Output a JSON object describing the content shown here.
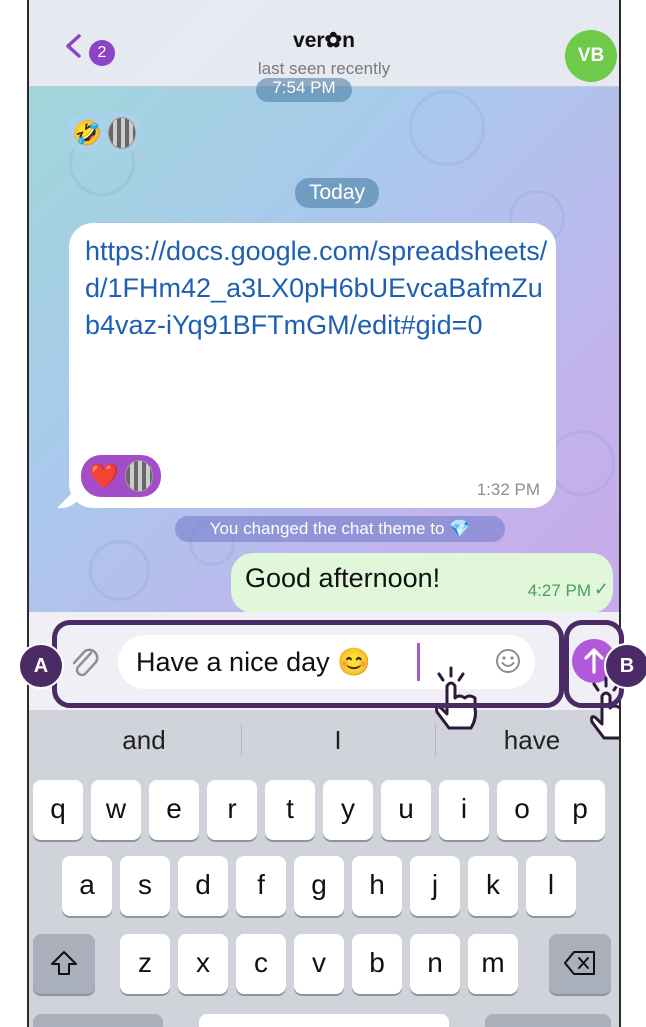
{
  "header": {
    "back_badge": "2",
    "contact_name": "ver✿n",
    "status": "last seen recently",
    "avatar_initials": "VB"
  },
  "messages": {
    "earlier_time": "7:54 PM",
    "earlier_reactions": [
      "🤣"
    ],
    "date_separator": "Today",
    "incoming": {
      "text": "https://docs.google.com/spreadsheets/d/1FHm42_a3LX0pH6bUEvcaBafmZub4vaz-iYq91BFTmGM/edit#gid=0",
      "reaction": "❤️",
      "time": "1:32 PM"
    },
    "service": "You changed the chat theme to 💎",
    "outgoing": {
      "text": "Good afternoon!",
      "time": "4:27 PM",
      "status": "✓"
    }
  },
  "composer": {
    "value": "Have a nice day 😊"
  },
  "markers": {
    "a": "A",
    "b": "B"
  },
  "keyboard": {
    "suggestions": [
      "and",
      "I",
      "have"
    ],
    "row1": [
      "q",
      "w",
      "e",
      "r",
      "t",
      "y",
      "u",
      "i",
      "o",
      "p"
    ],
    "row2": [
      "a",
      "s",
      "d",
      "f",
      "g",
      "h",
      "j",
      "k",
      "l"
    ],
    "row3": [
      "z",
      "x",
      "c",
      "v",
      "b",
      "n",
      "m"
    ],
    "shift_icon": "shift-arrow-icon",
    "delete_icon": "backspace-icon"
  },
  "colors": {
    "accent": "#b15ad9",
    "badge": "#8b44c8",
    "avatar": "#6fc94a",
    "highlight": "#4a2b65",
    "link": "#1e5fb4",
    "outgoing_bubble": "#e0f8d9"
  }
}
